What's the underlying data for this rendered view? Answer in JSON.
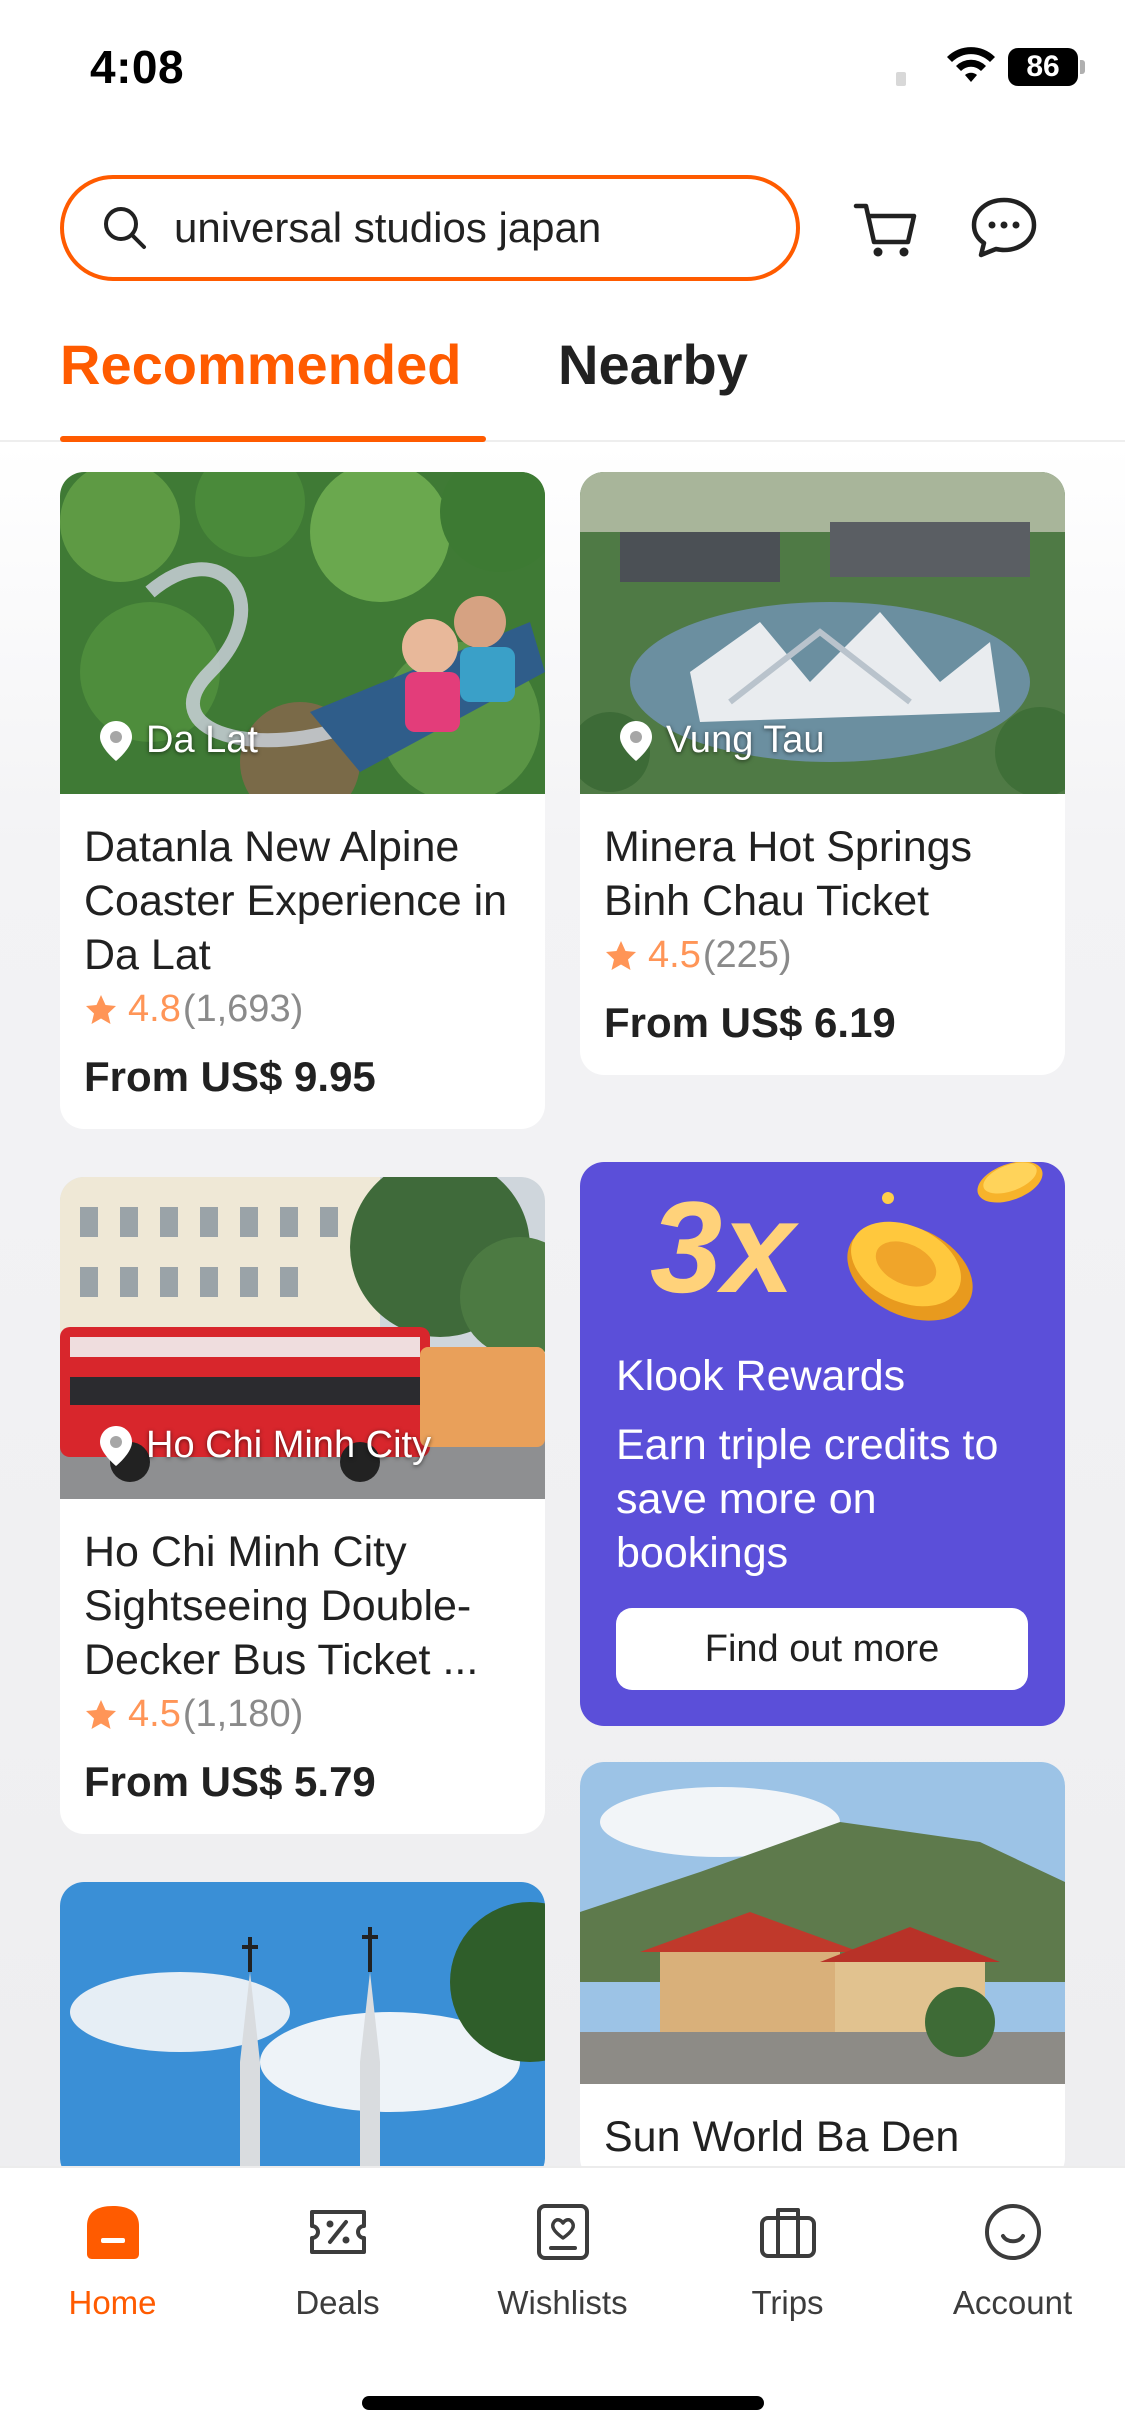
{
  "status_bar": {
    "time": "4:08",
    "battery": "86"
  },
  "search": {
    "query": "universal studios japan",
    "icon": "search-icon"
  },
  "header_icons": {
    "cart": "cart-icon",
    "messages": "chat-icon"
  },
  "tabs": [
    {
      "label": "Recommended",
      "active": true
    },
    {
      "label": "Nearby",
      "active": false
    }
  ],
  "cards": [
    {
      "location": "Da Lat",
      "title": "Datanla New Alpine Coaster Experience in Da Lat",
      "rating": "4.8",
      "reviews": "(1,693)",
      "price": "From US$ 9.95"
    },
    {
      "location": "Vung Tau",
      "title": "Minera Hot Springs Binh Chau Ticket",
      "rating": "4.5",
      "reviews": "(225)",
      "price": "From US$ 6.19"
    },
    {
      "location": "Ho Chi Minh City",
      "title": "Ho Chi Minh City Sightseeing Double-Decker Bus Ticket ...",
      "rating": "4.5",
      "reviews": "(1,180)",
      "price": "From US$ 5.79"
    },
    {
      "location": "",
      "title": "",
      "rating": "",
      "reviews": "",
      "price": ""
    },
    {
      "location": "",
      "title": "Sun World Ba Den",
      "rating": "",
      "reviews": "",
      "price": ""
    }
  ],
  "promo": {
    "multiplier": "3x",
    "title": "Klook Rewards",
    "description": "Earn triple credits to save more on bookings",
    "button": "Find out more"
  },
  "bottom_nav": [
    {
      "label": "Home",
      "icon": "home-icon",
      "active": true
    },
    {
      "label": "Deals",
      "icon": "deals-icon",
      "active": false
    },
    {
      "label": "Wishlists",
      "icon": "wishlist-icon",
      "active": false
    },
    {
      "label": "Trips",
      "icon": "trips-icon",
      "active": false
    },
    {
      "label": "Account",
      "icon": "account-icon",
      "active": false
    }
  ],
  "colors": {
    "accent": "#ff5b00",
    "promo_bg": "#5b4fd9",
    "rating": "#ff9557"
  }
}
